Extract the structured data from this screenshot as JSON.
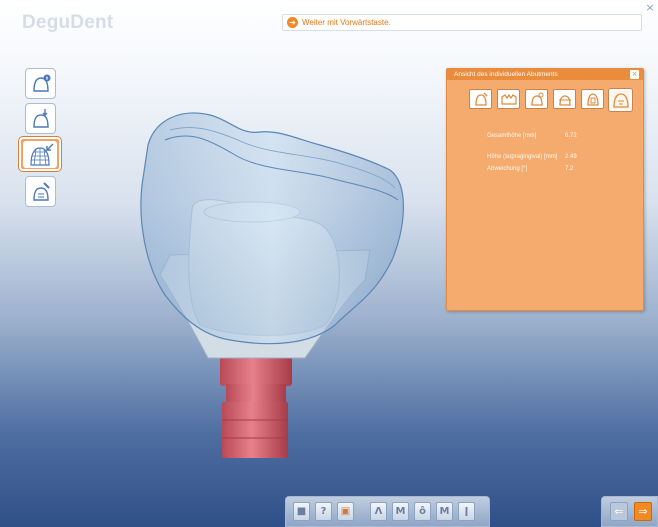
{
  "app": {
    "logo_text": "DeguDent",
    "close_glyph": "×"
  },
  "instruction": {
    "icon": "arrow-right-circle-icon",
    "text": "Weiter mit Vorwärtstaste."
  },
  "side_toolbar": [
    {
      "icon": "crown-info-icon",
      "active": false
    },
    {
      "icon": "crown-down-icon",
      "active": false
    },
    {
      "icon": "mesh-crown-icon",
      "active": true
    },
    {
      "icon": "crown-edit-icon",
      "active": false
    }
  ],
  "panel": {
    "title": "Ansicht des individuellen Abutments",
    "close_glyph": "×",
    "tools": [
      {
        "icon": "abutment-tool-1-icon",
        "selected": false
      },
      {
        "icon": "abutment-tool-2-icon",
        "selected": false
      },
      {
        "icon": "abutment-tool-3-icon",
        "selected": false
      },
      {
        "icon": "abutment-tool-4-icon",
        "selected": false
      },
      {
        "icon": "abutment-tool-5-icon",
        "selected": false
      },
      {
        "icon": "abutment-tool-6-icon",
        "selected": true
      }
    ],
    "params": [
      {
        "label": "Gesamthöhe [mm]",
        "value": "6.72"
      },
      {
        "label": "Höhe (supragingival) [mm]",
        "value": "2.49"
      },
      {
        "label": "Abweichung [°]",
        "value": "7.2"
      }
    ]
  },
  "bottom_toolbar": {
    "buttons": [
      {
        "icon": "save-icon",
        "glyph": "■"
      },
      {
        "icon": "help-icon",
        "glyph": "?"
      },
      {
        "icon": "print-icon",
        "glyph": "▣"
      },
      {
        "icon": "abutment-view-icon",
        "glyph": "Ʌ"
      },
      {
        "icon": "arch-view-icon",
        "glyph": "M"
      },
      {
        "icon": "tooth-view-icon",
        "glyph": "ô"
      },
      {
        "icon": "crown-view-icon",
        "glyph": "M"
      },
      {
        "icon": "implant-view-icon",
        "glyph": "ǀ"
      }
    ]
  },
  "nav": {
    "back_glyph": "⇐",
    "forward_glyph": "⇒"
  },
  "colors": {
    "accent": "#f08a24",
    "panel": "#f6ab6e",
    "implant": "#d4606a"
  }
}
